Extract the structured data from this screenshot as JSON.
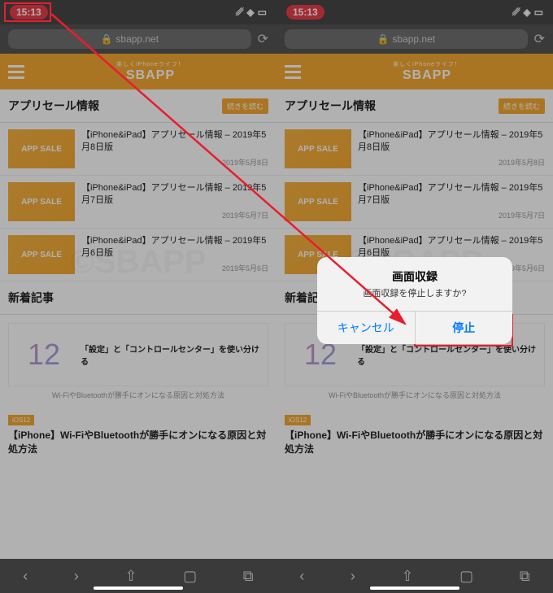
{
  "status": {
    "time": "15:13"
  },
  "addr": {
    "url": "sbapp.net"
  },
  "logo": {
    "tag": "楽しくiPhoneライフ！",
    "name": "SBAPP"
  },
  "sale": {
    "title": "アプリセール情報",
    "more": "続きを読む",
    "thumb": "APP SALE",
    "items": [
      {
        "t": "【iPhone&iPad】アプリセール情報 – 2019年5月8日版",
        "d": "2019年5月8日"
      },
      {
        "t": "【iPhone&iPad】アプリセール情報 – 2019年5月7日版",
        "d": "2019年5月7日"
      },
      {
        "t": "【iPhone&iPad】アプリセール情報 – 2019年5月6日版",
        "d": "2019年5月6日"
      }
    ]
  },
  "new": {
    "title": "新着記事",
    "icon": "12",
    "lead": "「設定」と「コントロールセンター」を使い分ける",
    "sub": "Wi-FiやBluetoothが勝手にオンになる原因と対処方法",
    "tag": "iOS12",
    "art": "【iPhone】Wi-FiやBluetoothが勝手にオンになる原因と対処方法"
  },
  "alert": {
    "title": "画面収録",
    "msg": "画面収録を停止しますか?",
    "cancel": "キャンセル",
    "stop": "停止"
  },
  "wm": "©SBAPP"
}
